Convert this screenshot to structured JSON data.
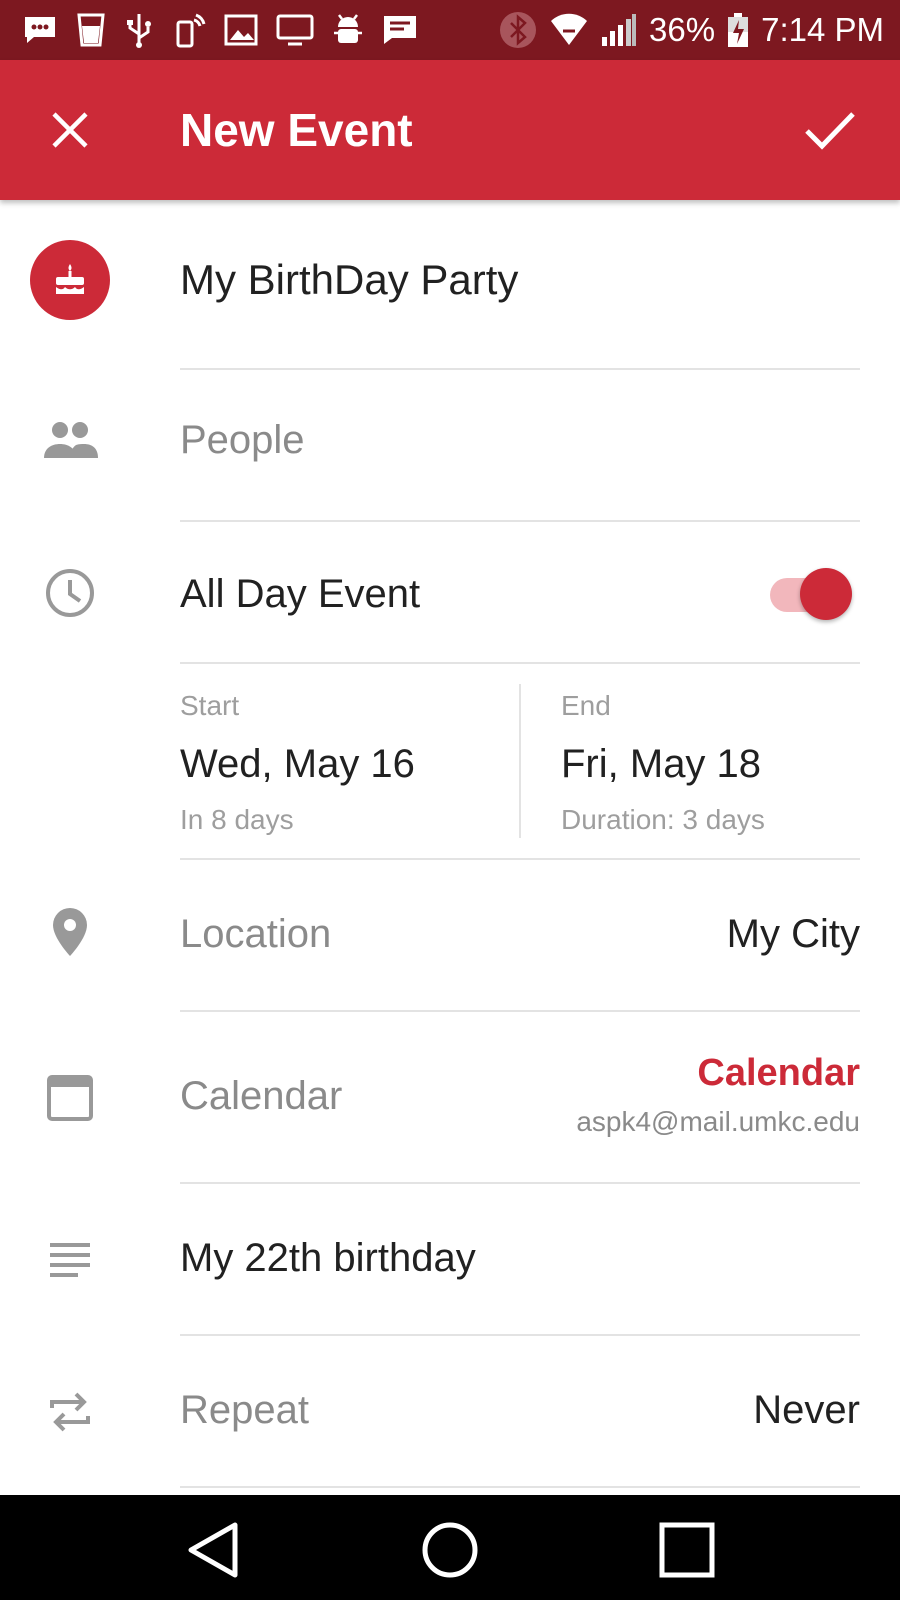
{
  "status_bar": {
    "battery": "36%",
    "time": "7:14 PM"
  },
  "app_bar": {
    "title": "New Event",
    "close_icon": "close-icon",
    "save_icon": "check-icon"
  },
  "form": {
    "title_value": "My BirthDay Party",
    "people_placeholder": "People",
    "all_day_label": "All Day Event",
    "all_day_enabled": true,
    "start": {
      "label": "Start",
      "date": "Wed, May 16",
      "relative": "In 8 days"
    },
    "end": {
      "label": "End",
      "date": "Fri, May 18",
      "duration": "Duration: 3 days"
    },
    "location_label": "Location",
    "location_value": "My City",
    "calendar_label": "Calendar",
    "calendar_name": "Calendar",
    "calendar_account": "aspk4@mail.umkc.edu",
    "description_value": "My 22th birthday",
    "repeat_label": "Repeat",
    "repeat_value": "Never"
  },
  "colors": {
    "accent": "#cc2a38",
    "status_bar": "#7d1820"
  }
}
